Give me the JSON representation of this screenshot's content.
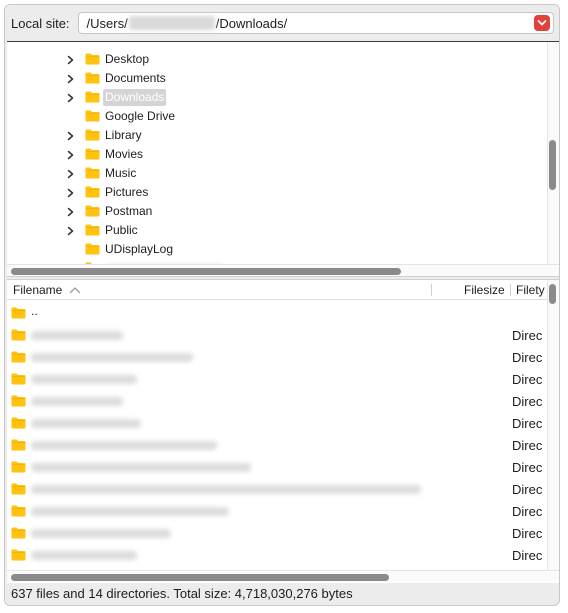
{
  "site_bar": {
    "label": "Local site:",
    "path_prefix": "/Users/",
    "path_suffix": "/Downloads/"
  },
  "tree": {
    "items": [
      {
        "label": "Desktop",
        "expandable": true,
        "selected": false
      },
      {
        "label": "Documents",
        "expandable": true,
        "selected": false
      },
      {
        "label": "Downloads",
        "expandable": true,
        "selected": true
      },
      {
        "label": "Google Drive",
        "expandable": false,
        "selected": false
      },
      {
        "label": "Library",
        "expandable": true,
        "selected": false
      },
      {
        "label": "Movies",
        "expandable": true,
        "selected": false
      },
      {
        "label": "Music",
        "expandable": true,
        "selected": false
      },
      {
        "label": "Pictures",
        "expandable": true,
        "selected": false
      },
      {
        "label": "Postman",
        "expandable": true,
        "selected": false
      },
      {
        "label": "Public",
        "expandable": true,
        "selected": false
      },
      {
        "label": "UDisplayLog",
        "expandable": false,
        "selected": false
      }
    ]
  },
  "file_list": {
    "columns": {
      "filename": "Filename",
      "filesize": "Filesize",
      "filetype": "Filety"
    },
    "parent_entry": "..",
    "rows": [
      {
        "type": "Direc"
      },
      {
        "type": "Direc"
      },
      {
        "type": "Direc"
      },
      {
        "type": "Direc"
      },
      {
        "type": "Direc"
      },
      {
        "type": "Direc"
      },
      {
        "type": "Direc"
      },
      {
        "type": "Direc"
      },
      {
        "type": "Direc"
      },
      {
        "type": "Direc"
      },
      {
        "type": "Direc"
      }
    ]
  },
  "status_bar": {
    "text": "637 files and 14 directories. Total size: 4,718,030,276 bytes"
  },
  "colors": {
    "folder": "#ffc20e",
    "accent_red": "#e0413a",
    "scroll_thumb": "#8a8a8a"
  }
}
